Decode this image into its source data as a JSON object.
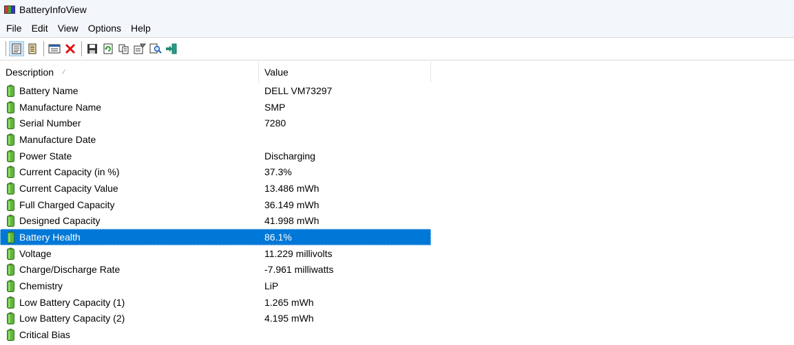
{
  "window": {
    "title": "BatteryInfoView"
  },
  "menu": [
    "File",
    "Edit",
    "View",
    "Options",
    "Help"
  ],
  "toolbar": {
    "buttons": [
      "html-report-icon",
      "text-report-icon",
      "window-icon",
      "delete-icon",
      "save-icon",
      "refresh-icon",
      "copy-icon",
      "properties-icon",
      "find-icon",
      "exit-icon"
    ]
  },
  "columns": {
    "description": "Description",
    "value": "Value"
  },
  "rows": [
    {
      "description": "Battery Name",
      "value": "DELL VM73297"
    },
    {
      "description": "Manufacture Name",
      "value": "SMP"
    },
    {
      "description": "Serial Number",
      "value": "7280"
    },
    {
      "description": "Manufacture Date",
      "value": ""
    },
    {
      "description": "Power State",
      "value": "Discharging"
    },
    {
      "description": "Current Capacity (in %)",
      "value": "37.3%"
    },
    {
      "description": "Current Capacity Value",
      "value": "13.486 mWh"
    },
    {
      "description": "Full Charged Capacity",
      "value": "36.149 mWh"
    },
    {
      "description": "Designed Capacity",
      "value": "41.998 mWh"
    },
    {
      "description": "Battery Health",
      "value": "86.1%",
      "selected": true
    },
    {
      "description": "Voltage",
      "value": "11.229 millivolts"
    },
    {
      "description": "Charge/Discharge Rate",
      "value": "-7.961 milliwatts"
    },
    {
      "description": "Chemistry",
      "value": "LiP"
    },
    {
      "description": "Low Battery Capacity (1)",
      "value": "1.265 mWh"
    },
    {
      "description": "Low Battery Capacity (2)",
      "value": "4.195 mWh"
    },
    {
      "description": "Critical Bias",
      "value": ""
    }
  ],
  "colors": {
    "selection": "#0078d7",
    "battery_green": "#5fb83a"
  }
}
